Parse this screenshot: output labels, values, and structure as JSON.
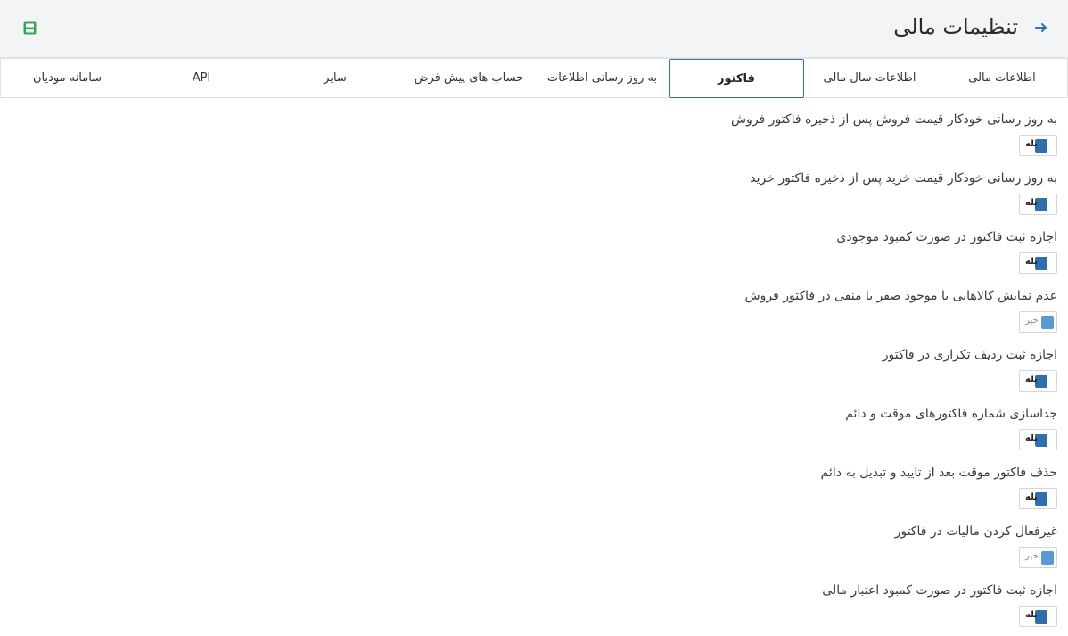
{
  "header": {
    "title": "تنظیمات مالی",
    "back_icon": "arrow-right-icon",
    "save_icon": "save-icon",
    "accent": "#2d73b3",
    "save_color": "#3aa35b"
  },
  "tabs": [
    {
      "label": "اطلاعات مالی",
      "active": false
    },
    {
      "label": "اطلاعات سال مالی",
      "active": false
    },
    {
      "label": "فاکتور",
      "active": true
    },
    {
      "label": "به روز رسانی اطلاعات",
      "active": false
    },
    {
      "label": "حساب های پیش فرض",
      "active": false
    },
    {
      "label": "سایر",
      "active": false
    },
    {
      "label": "API",
      "active": false
    },
    {
      "label": "سامانه مودیان",
      "active": false
    }
  ],
  "settings": [
    {
      "label": "به روز رسانی خودکار قیمت فروش پس از ذخیره فاکتور فروش",
      "value": "بله",
      "on": true
    },
    {
      "label": "به روز رسانی خودکار قیمت خرید پس از ذخیره فاکتور خرید",
      "value": "بله",
      "on": true
    },
    {
      "label": "اجازه ثبت فاکتور در صورت کمبود موجودی",
      "value": "بله",
      "on": true
    },
    {
      "label": "عدم نمایش کالاهایی با موجود صفر یا منفی در فاکتور فروش",
      "value": "خیر",
      "on": false
    },
    {
      "label": "اجازه ثبت ردیف تکراری در فاکتور",
      "value": "بله",
      "on": true
    },
    {
      "label": "جداسازی شماره فاکتورهای موقت و دائم",
      "value": "بله",
      "on": true
    },
    {
      "label": "حذف فاکتور موقت بعد از تایید و تبدیل به دائم",
      "value": "بله",
      "on": true
    },
    {
      "label": "غیرفعال کردن مالیات در فاکتور",
      "value": "خیر",
      "on": false
    },
    {
      "label": "اجازه ثبت فاکتور در صورت کمبود اعتبار مالی",
      "value": "بله",
      "on": true
    }
  ]
}
